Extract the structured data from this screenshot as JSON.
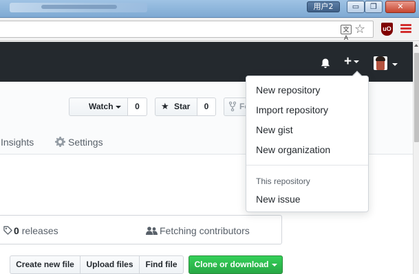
{
  "window": {
    "user_badge": "用户2",
    "min_label": "▭",
    "max_label": "❐",
    "close_label": "✕"
  },
  "browser": {
    "translate_icon_label": "文A",
    "star_glyph": "☆",
    "ublock_label": "uO"
  },
  "header": {
    "plus_label": "+"
  },
  "repo": {
    "watch_label": "Watch",
    "watch_count": "0",
    "star_label": "Star",
    "star_count": "0",
    "fork_label_partial": "Fo",
    "tabs": {
      "insights": "Insights",
      "settings": "Settings"
    }
  },
  "stats": {
    "releases_count": "0",
    "releases_label": "releases",
    "contributors_label": "Fetching contributors"
  },
  "file_buttons": {
    "create": "Create new file",
    "upload": "Upload files",
    "find": "Find file",
    "clone": "Clone or download"
  },
  "dropdown": {
    "items": [
      "New repository",
      "Import repository",
      "New gist",
      "New organization"
    ],
    "section_header": "This repository",
    "section_item": "New issue"
  },
  "colors": {
    "header_bg": "#24292e",
    "clone_green": "#28a745",
    "ublock_red": "#800000",
    "chrome_menu_red": "#d32f2f"
  }
}
